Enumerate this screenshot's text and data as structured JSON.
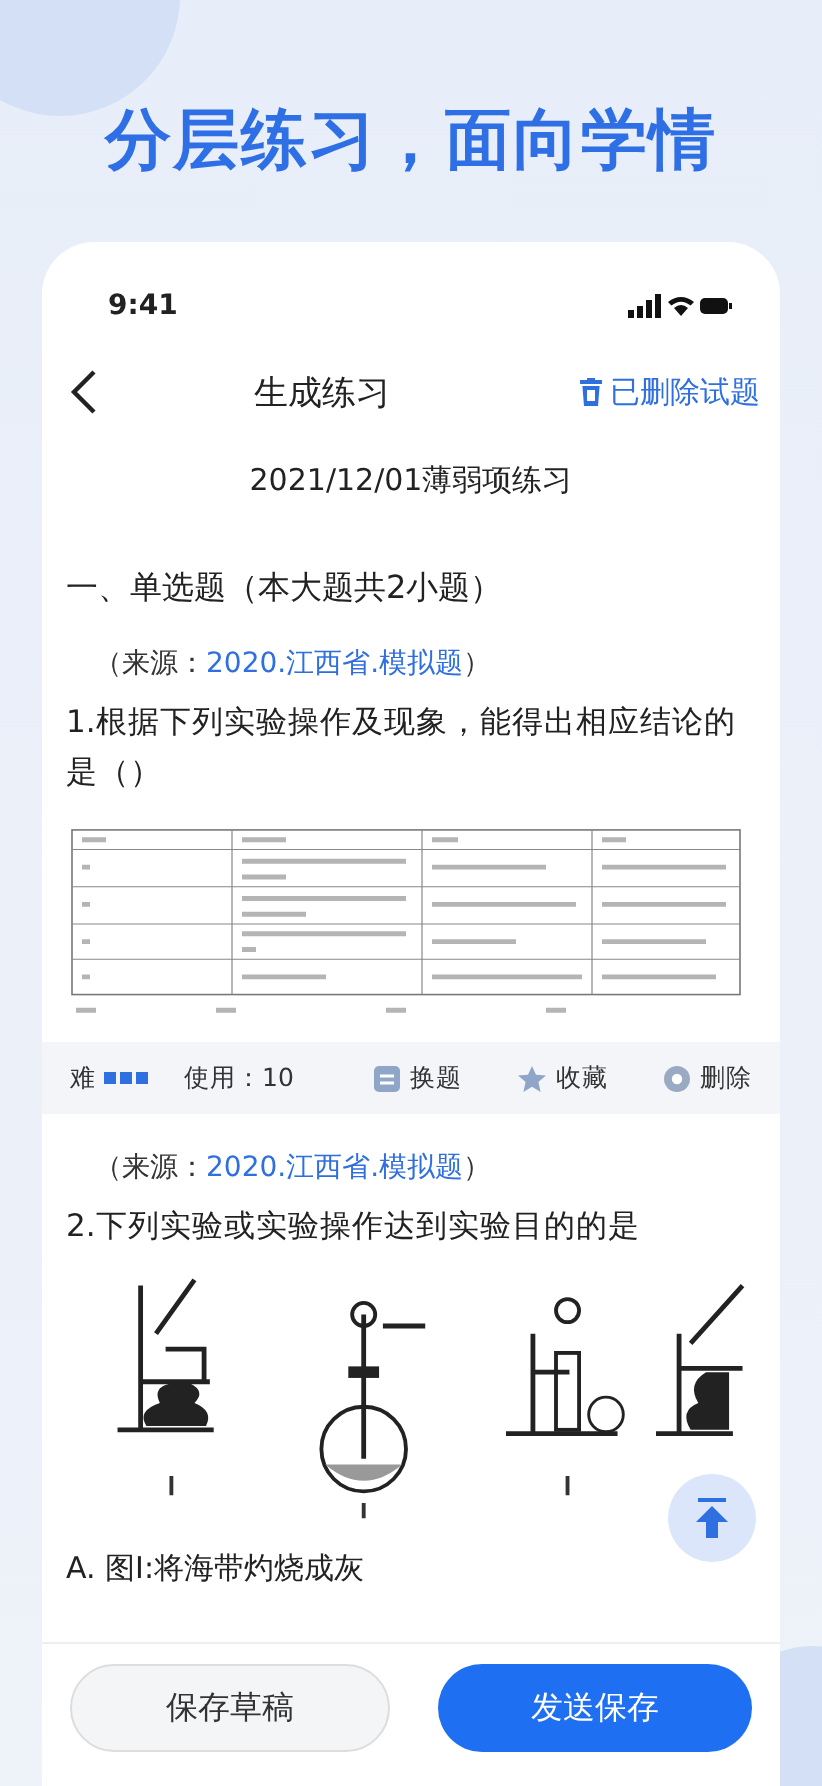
{
  "headline": "分层练习，面向学情",
  "status_bar": {
    "time": "9:41"
  },
  "nav": {
    "title": "生成练习",
    "action": "已删除试题"
  },
  "paper_title": "2021/12/01薄弱项练习",
  "section": "一、单选题（本大题共2小题）",
  "questions": [
    {
      "source_prefix": "（来源：",
      "source": "2020.江西省.模拟题",
      "source_suffix": "）",
      "text": "1.根据下列实验操作及现象，能得出相应结论的是（）",
      "figure": {
        "kind": "table"
      },
      "toolbar": {
        "difficulty": "难",
        "stars": 3,
        "usage": "使用：10",
        "actions": [
          "换题",
          "收藏",
          "删除"
        ]
      }
    },
    {
      "source_prefix": "（来源：",
      "source": "2020.江西省.模拟题",
      "source_suffix": "）",
      "text": "2.下列实验或实验操作达到实验目的的是",
      "figure": {
        "kind": "apparatus"
      },
      "options": [
        "A. 图I:将海带灼烧成灰"
      ]
    }
  ],
  "buttons": {
    "draft": "保存草稿",
    "send": "发送保存"
  }
}
